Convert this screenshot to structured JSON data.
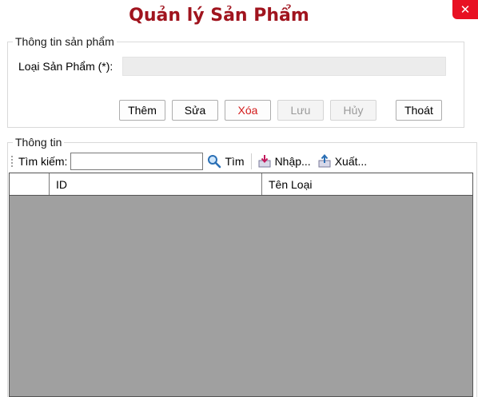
{
  "window": {
    "title": "Quản lý Sản Phẩm",
    "close_symbol": "✕"
  },
  "product_group": {
    "legend": "Thông tin sản phẩm",
    "category_label": "Loại Sản Phẩm (*):",
    "category_value": "",
    "buttons": [
      {
        "label": "Thêm",
        "enabled": true
      },
      {
        "label": "Sửa",
        "enabled": true
      },
      {
        "label": "Xóa",
        "enabled": true,
        "color": "#d31b1b"
      },
      {
        "label": "Lưu",
        "enabled": false
      },
      {
        "label": "Hủy",
        "enabled": false
      },
      {
        "label": "Thoát",
        "enabled": true
      }
    ]
  },
  "info_group": {
    "legend": "Thông tin",
    "toolbar": {
      "search_label": "Tìm kiếm:",
      "search_value": "",
      "search_button": "Tìm",
      "import_button": "Nhập...",
      "export_button": "Xuất..."
    },
    "grid": {
      "columns": [
        "",
        "ID",
        "Tên Loại"
      ],
      "rows": []
    }
  },
  "colors": {
    "title": "#a0141e",
    "close": "#e81123",
    "grid_background": "#a0a0a0"
  }
}
